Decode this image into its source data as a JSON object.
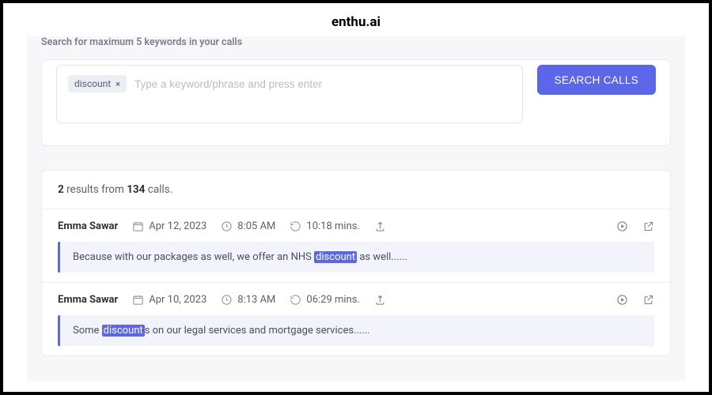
{
  "brand": "enthu.ai",
  "search": {
    "label": "Search for maximum 5 keywords in your calls",
    "chips": [
      "discount"
    ],
    "placeholder": "Type a keyword/phrase and press enter",
    "button": "SEARCH CALLS"
  },
  "results": {
    "count": "2",
    "summary_mid": "results from",
    "total": "134",
    "summary_tail": "calls.",
    "items": [
      {
        "name": "Emma Sawar",
        "date": "Apr 12, 2023",
        "time": "8:05 AM",
        "duration": "10:18 mins.",
        "snippet_pre": "Because with our packages as well, we offer an NHS ",
        "highlight": "discount",
        "snippet_post": " as well......"
      },
      {
        "name": "Emma Sawar",
        "date": "Apr 10, 2023",
        "time": "8:13 AM",
        "duration": "06:29 mins.",
        "snippet_pre": "Some ",
        "highlight": "discount",
        "snippet_post": "s on our legal services and mortgage services......"
      }
    ]
  }
}
